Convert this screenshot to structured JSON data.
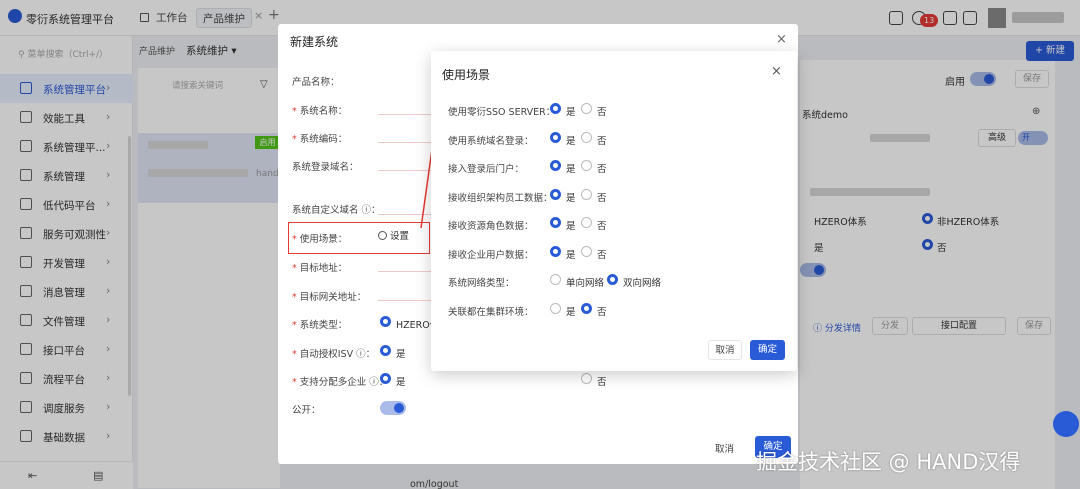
{
  "topbar": {
    "app_title": "零衍系统管理平台",
    "tabs": [
      {
        "label": "工作台"
      },
      {
        "label": "产品维护"
      }
    ],
    "tab_close": "×",
    "add_tab": "+",
    "notification_count": "13"
  },
  "sidebar": {
    "search_placeholder": "菜单搜索（Ctrl+/）",
    "items": [
      {
        "label": "系统管理平台",
        "icon": "platform-icon"
      },
      {
        "label": "效能工具",
        "icon": "tool-icon"
      },
      {
        "label": "系统管理平...",
        "icon": "system-icon"
      },
      {
        "label": "系统管理",
        "icon": "settings-icon"
      },
      {
        "label": "低代码平台",
        "icon": "lowcode-icon"
      },
      {
        "label": "服务可观测性",
        "icon": "monitor-icon"
      },
      {
        "label": "开发管理",
        "icon": "dev-icon"
      },
      {
        "label": "消息管理",
        "icon": "message-icon"
      },
      {
        "label": "文件管理",
        "icon": "file-icon"
      },
      {
        "label": "接口平台",
        "icon": "api-icon"
      },
      {
        "label": "流程平台",
        "icon": "flow-icon"
      },
      {
        "label": "调度服务",
        "icon": "schedule-icon"
      },
      {
        "label": "基础数据",
        "icon": "data-icon"
      }
    ],
    "chevron": "›"
  },
  "content": {
    "breadcrumb": "产品维护",
    "selector": "系统维护 ▾",
    "list_search_placeholder": "请搜索关键词",
    "status_tag": "启用",
    "row_text": "hand",
    "new_button": "+ 新建",
    "right": {
      "enable_label": "启用",
      "save_label": "保存",
      "system_demo": "系统demo",
      "advanced": "高级",
      "on": "开",
      "hzero": "HZERO体系",
      "non_hzero": "非HZERO体系",
      "yes": "是",
      "no": "否",
      "dispatch_detail": "ⓘ 分发详情",
      "dispatch": "分发",
      "interface_config": "接口配置",
      "save2": "保存"
    },
    "logout_text": "om/logout"
  },
  "modal_back": {
    "title": "新建系统",
    "close": "×",
    "fields": [
      {
        "label": "产品名称：",
        "required": false
      },
      {
        "label": "系统名称：",
        "required": true
      },
      {
        "label": "系统编码：",
        "required": true
      },
      {
        "label": "系统登录域名：",
        "required": false
      },
      {
        "label": "系统自定义域名 ⓘ：",
        "required": false
      },
      {
        "label": "使用场景：",
        "required": true
      },
      {
        "label": "目标地址：",
        "required": true
      },
      {
        "label": "目标网关地址：",
        "required": true
      },
      {
        "label": "系统类型：",
        "required": true
      },
      {
        "label": "自动授权ISV ⓘ：",
        "required": true
      },
      {
        "label": "支持分配多企业 ⓘ：",
        "required": true
      },
      {
        "label": "公开：",
        "required": false
      }
    ],
    "settings_button": "设置",
    "system_type_value": "HZERO体",
    "yes": "是",
    "no": "否",
    "cancel": "取消",
    "ok": "确定"
  },
  "modal_front": {
    "title": "使用场景",
    "close": "×",
    "rows": [
      {
        "label": "使用零衍SSO SERVER：",
        "options": [
          "是",
          "否"
        ],
        "selected": 0
      },
      {
        "label": "使用系统域名登录：",
        "options": [
          "是",
          "否"
        ],
        "selected": 0
      },
      {
        "label": "接入登录后门户：",
        "options": [
          "是",
          "否"
        ],
        "selected": 0
      },
      {
        "label": "接收组织架构员工数据：",
        "options": [
          "是",
          "否"
        ],
        "selected": 0
      },
      {
        "label": "接收资源角色数据：",
        "options": [
          "是",
          "否"
        ],
        "selected": 0
      },
      {
        "label": "接收企业用户数据：",
        "options": [
          "是",
          "否"
        ],
        "selected": 0
      },
      {
        "label": "系统网络类型：",
        "options": [
          "单向网络",
          "双向网络"
        ],
        "selected": 1
      },
      {
        "label": "关联都在集群环境：",
        "options": [
          "是",
          "否"
        ],
        "selected": 1
      }
    ],
    "cancel": "取消",
    "ok": "确定"
  },
  "watermark": "掘金技术社区 @ HAND汉得",
  "colors": {
    "accent": "#2a5bd7",
    "danger": "#e53935",
    "success": "#52c41a"
  }
}
